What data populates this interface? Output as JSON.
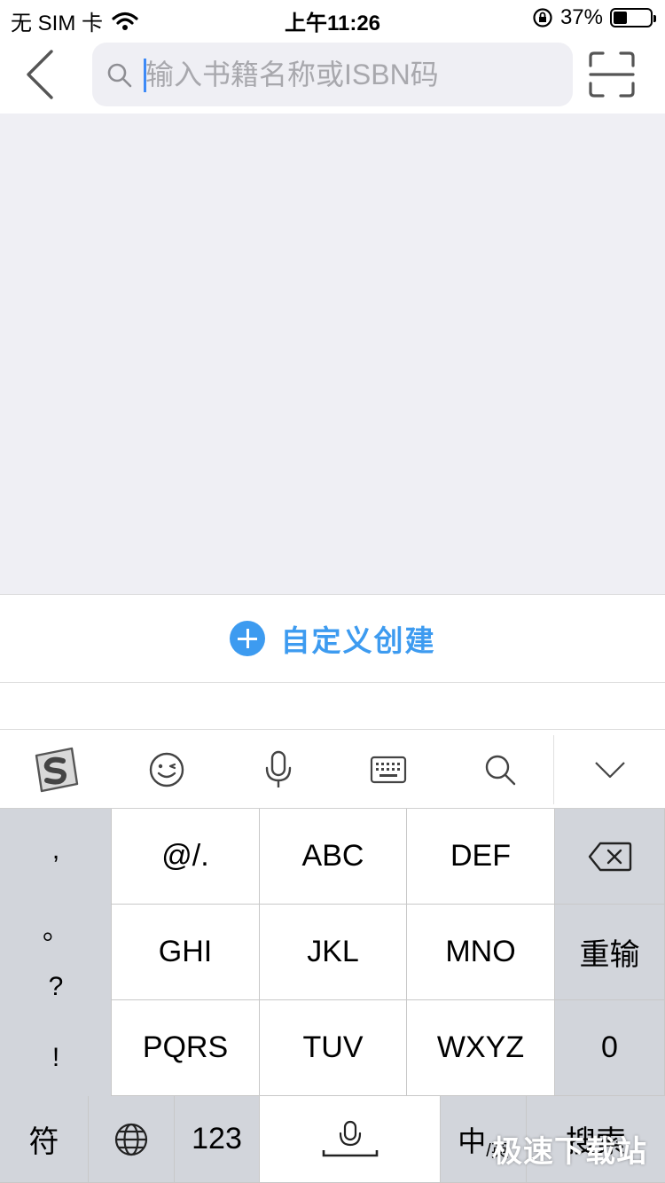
{
  "status_bar": {
    "carrier": "无 SIM 卡",
    "time": "上午11:26",
    "battery_percent": "37%",
    "battery_level": 0.37
  },
  "nav": {
    "search_placeholder": "输入书籍名称或ISBN码"
  },
  "create": {
    "label": "自定义创建",
    "accent_color": "#3d9bf0"
  },
  "keyboard": {
    "punctuation": [
      ",",
      "。",
      "?",
      "!"
    ],
    "rows": [
      [
        "@/.",
        "ABC",
        "DEF"
      ],
      [
        "GHI",
        "JKL",
        "MNO"
      ],
      [
        "PQRS",
        "TUV",
        "WXYZ"
      ]
    ],
    "reinput": "重输",
    "zero": "0",
    "bottom": {
      "symbols": "符",
      "numbers": "123",
      "lang_main": "中",
      "lang_sub": "/英",
      "search": "搜索"
    }
  },
  "watermark": "极速下载站"
}
